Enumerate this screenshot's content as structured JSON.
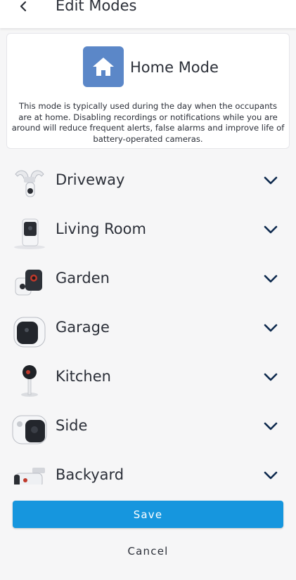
{
  "header": {
    "title": "Edit Modes",
    "back_icon": "chevron-left-icon"
  },
  "mode": {
    "icon": "home-icon",
    "icon_color": "#5b87c8",
    "name": "Home Mode",
    "description": "This mode is typically used during the day when the occupants are at home. Disabling recordings or notifications while you are around will reduce frequent alerts, false alarms and improve life of battery-operated cameras."
  },
  "cameras": [
    {
      "label": "Driveway",
      "icon": "floodlight-camera-icon"
    },
    {
      "label": "Living Room",
      "icon": "indoor-camera-icon"
    },
    {
      "label": "Garden",
      "icon": "wire-free-camera-icon"
    },
    {
      "label": "Garage",
      "icon": "battery-camera-icon"
    },
    {
      "label": "Kitchen",
      "icon": "stand-camera-icon"
    },
    {
      "label": "Side",
      "icon": "battery-camera-icon"
    },
    {
      "label": "Backyard",
      "icon": "bullet-camera-icon"
    }
  ],
  "actions": {
    "save_label": "Save",
    "cancel_label": "Cancel"
  },
  "colors": {
    "accent": "#1696de",
    "chevron": "#0e2a4e"
  }
}
